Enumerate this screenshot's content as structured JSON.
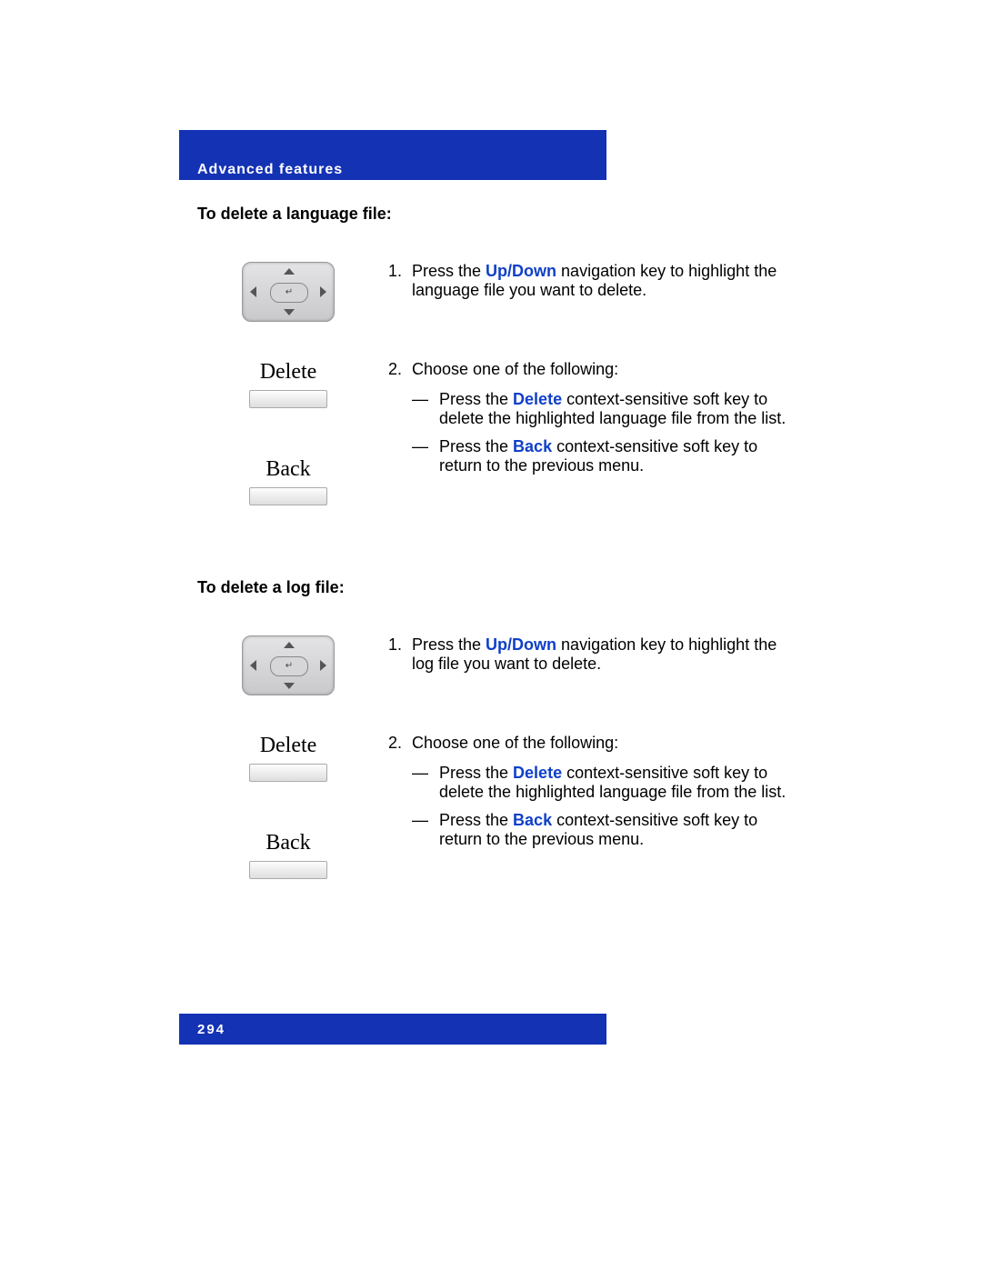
{
  "header": {
    "title": "Advanced features"
  },
  "section1": {
    "title": "To delete a language file:",
    "step1_prefix": "Press the ",
    "step1_kw": "Up/Down",
    "step1_suffix": " navigation key to highlight the language file you want to delete.",
    "step2_intro": "Choose one of the following:",
    "step2_a_prefix": "Press the ",
    "step2_a_kw": "Delete",
    "step2_a_suffix": " context-sensitive soft key to delete the highlighted language file from the list.",
    "step2_b_prefix": "Press the ",
    "step2_b_kw": "Back",
    "step2_b_suffix": " context-sensitive soft key to return to the previous menu.",
    "softkey_delete": "Delete",
    "softkey_back": "Back"
  },
  "section2": {
    "title": "To delete a log file:",
    "step1_prefix": "Press the ",
    "step1_kw": "Up/Down",
    "step1_suffix": " navigation key to highlight the log file you want to delete.",
    "step2_intro": "Choose one of the following:",
    "step2_a_prefix": "Press the ",
    "step2_a_kw": "Delete",
    "step2_a_suffix": " context-sensitive soft key to delete the highlighted language file from the list.",
    "step2_b_prefix": "Press the ",
    "step2_b_kw": "Back",
    "step2_b_suffix": " context-sensitive soft key to return to the previous menu.",
    "softkey_delete": "Delete",
    "softkey_back": "Back"
  },
  "num1": "1.",
  "num2": "2.",
  "dash": "—",
  "footer": {
    "page": "294"
  }
}
